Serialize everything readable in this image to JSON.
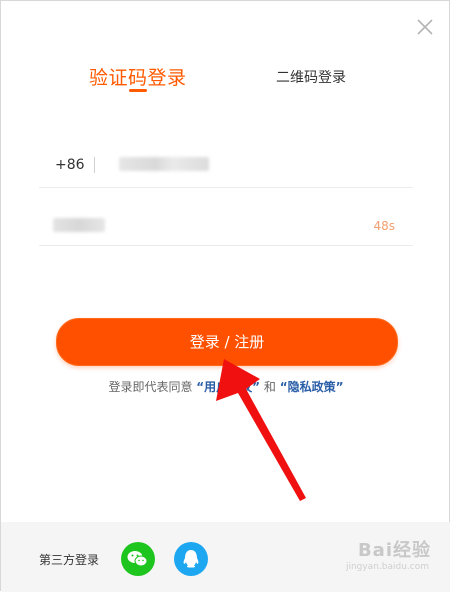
{
  "dialog": {
    "tabs": {
      "active": "验证码登录",
      "inactive": "二维码登录"
    },
    "phone": {
      "country_code": "+86"
    },
    "code": {
      "countdown": "48s"
    },
    "submit_label": "登录 / 注册",
    "agreement": {
      "prefix": "登录即代表同意",
      "user_agreement": "“用户协议”",
      "and": "和",
      "privacy": "“隐私政策”"
    },
    "third_party": {
      "label": "第三方登录",
      "services": [
        "wechat-icon",
        "qq-icon"
      ]
    },
    "watermark": {
      "text": "Bai经验",
      "sub": "jingyan.baidu.com"
    }
  },
  "colors": {
    "accent": "#ff5000",
    "link": "#2a5fa8",
    "wechat": "#1fc51f",
    "qq": "#1ea7f1",
    "arrow": "#f01010"
  }
}
